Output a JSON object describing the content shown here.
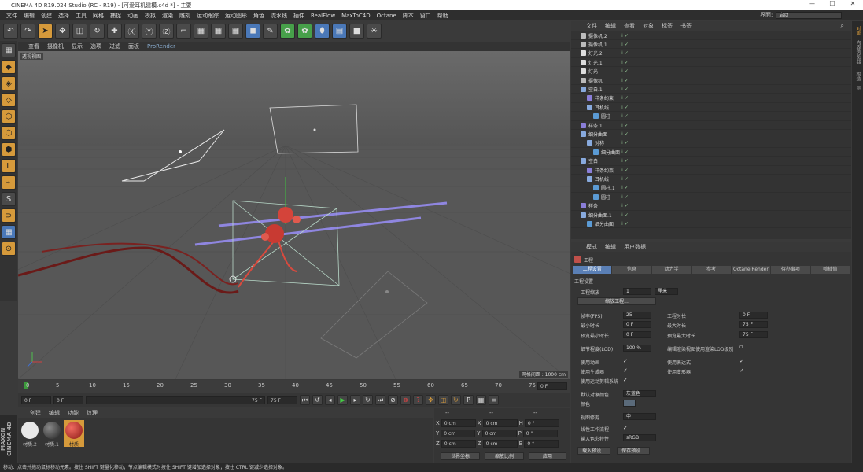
{
  "title": "CINEMA 4D R19.024 Studio (RC - R19) - [可爱耳机建模.c4d *] - 主要",
  "window_controls": [
    "—",
    "☐",
    "✕"
  ],
  "menu": [
    "文件",
    "编辑",
    "创建",
    "选择",
    "工具",
    "网格",
    "捕捉",
    "动画",
    "模拟",
    "渲染",
    "雕刻",
    "运动跟踪",
    "运动图形",
    "角色",
    "流水线",
    "插件",
    "RealFlow",
    "MaxToC4D",
    "Octane",
    "脚本",
    "窗口",
    "帮助"
  ],
  "interface_label": "界面:",
  "interface_value": "启动",
  "viewport_menu": [
    "查看",
    "摄像机",
    "显示",
    "选项",
    "过滤",
    "面板",
    "ProRender"
  ],
  "viewport_label": "透视视图",
  "grid_info": "网格间距 : 1000 cm",
  "timeline_ticks": [
    "0",
    "5",
    "10",
    "15",
    "20",
    "25",
    "30",
    "35",
    "40",
    "45",
    "50",
    "55",
    "60",
    "65",
    "70",
    "75"
  ],
  "timeline_end": "0 F",
  "playbar": {
    "start": "0 F",
    "cur": "0 F",
    "end1": "75 F",
    "end2": "75 F"
  },
  "mat_menu": [
    "创建",
    "编辑",
    "功能",
    "纹理"
  ],
  "materials": [
    {
      "name": "材质.2",
      "color": "#e8e8e8"
    },
    {
      "name": "材质.1",
      "color": "#333333"
    },
    {
      "name": "材质",
      "color": "#c0231e"
    }
  ],
  "maxon": "MAXON CINEMA 4D",
  "coords": {
    "headers": [
      "--",
      "--",
      "--"
    ],
    "rows": [
      {
        "a": "X",
        "av": "0 cm",
        "b": "X",
        "bv": "0 cm",
        "c": "H",
        "cv": "0 °"
      },
      {
        "a": "Y",
        "av": "0 cm",
        "b": "Y",
        "bv": "0 cm",
        "c": "P",
        "cv": "0 °"
      },
      {
        "a": "Z",
        "av": "0 cm",
        "b": "Z",
        "bv": "0 cm",
        "c": "B",
        "cv": "0 °"
      }
    ],
    "mode1": "世界坐标",
    "mode2": "缩放比例",
    "apply": "应用"
  },
  "status": "移动：点击并拖动鼠标移动元素。按住 SHIFT 键量化移动；节点编辑模式时按住 SHIFT 键增加选择对象；按住 CTRL 键减少选择对象。",
  "obj_menu": [
    "文件",
    "编辑",
    "查看",
    "对象",
    "标签",
    "书签"
  ],
  "objects": [
    {
      "name": "摄像机.2",
      "indent": 0,
      "color": "#bbbbbb"
    },
    {
      "name": "摄像机.1",
      "indent": 0,
      "color": "#bbbbbb"
    },
    {
      "name": "灯光.2",
      "indent": 0,
      "color": "#dddddd"
    },
    {
      "name": "灯光.1",
      "indent": 0,
      "color": "#dddddd"
    },
    {
      "name": "灯光",
      "indent": 0,
      "color": "#dddddd"
    },
    {
      "name": "摄像机",
      "indent": 0,
      "color": "#bbbbbb"
    },
    {
      "name": "空白.1",
      "indent": 0,
      "color": "#88aadd"
    },
    {
      "name": "样条约束",
      "indent": 1,
      "color": "#8a7ed8"
    },
    {
      "name": "耳机线",
      "indent": 1,
      "color": "#88aadd"
    },
    {
      "name": "圆柱",
      "indent": 2,
      "color": "#5b9bd5"
    },
    {
      "name": "样条.1",
      "indent": 0,
      "color": "#8a7ed8"
    },
    {
      "name": "细分曲面",
      "indent": 0,
      "color": "#88aadd"
    },
    {
      "name": "对称",
      "indent": 1,
      "color": "#88aadd"
    },
    {
      "name": "细分曲面",
      "indent": 2,
      "color": "#5b9bd5"
    },
    {
      "name": "空白",
      "indent": 0,
      "color": "#88aadd"
    },
    {
      "name": "样条约束",
      "indent": 1,
      "color": "#8a7ed8"
    },
    {
      "name": "耳机线",
      "indent": 1,
      "color": "#88aadd"
    },
    {
      "name": "圆柱.1",
      "indent": 2,
      "color": "#5b9bd5"
    },
    {
      "name": "圆柱",
      "indent": 2,
      "color": "#5b9bd5"
    },
    {
      "name": "样条",
      "indent": 0,
      "color": "#8a7ed8"
    },
    {
      "name": "细分曲面.1",
      "indent": 0,
      "color": "#88aadd"
    },
    {
      "name": "细分曲面",
      "indent": 1,
      "color": "#5b9bd5"
    }
  ],
  "attr_menu": [
    "模式",
    "编辑",
    "用户数据"
  ],
  "attr_title": "工程",
  "attr_tabs": [
    "工程设置",
    "信息",
    "动力学",
    "参考",
    "Octane Render",
    "待办事项",
    "帧插值"
  ],
  "attr_section": "工程设置",
  "proj": {
    "scale_label": "工程缩放",
    "scale_val": "1",
    "scale_unit": "厘米",
    "scale_btn": "缩放工程...",
    "fps_label": "帧率(FPS)",
    "fps": "25",
    "time_label": "工程时长",
    "time": "0 F",
    "min_label": "最小时长",
    "min": "0 F",
    "max_label": "最大时长",
    "max": "75 F",
    "pmin_label": "预览最小时长",
    "pmin": "0 F",
    "pmax_label": "预览最大时长",
    "pmax": "75 F",
    "lod_label": "细节程度(LOD)",
    "lod": "100 %",
    "lod2_label": "编辑渲染视图使用渲染LOD级别",
    "c1": "使用动画",
    "c2": "使用表达式",
    "c3": "使用生成器",
    "c4": "使用变形器",
    "c5": "使用运动剪辑系统",
    "defcol_label": "默认对象颜色",
    "defcol": "灰蓝色",
    "color_label": "颜色",
    "clip_label": "视图修剪",
    "clip": "中",
    "linear_label": "线性工作流程",
    "input_label": "输入色彩特性",
    "input": "sRGB",
    "load": "载入预设...",
    "save": "保存预设..."
  },
  "right_strip": [
    "对象",
    "内容浏览器",
    "构造",
    "层"
  ]
}
